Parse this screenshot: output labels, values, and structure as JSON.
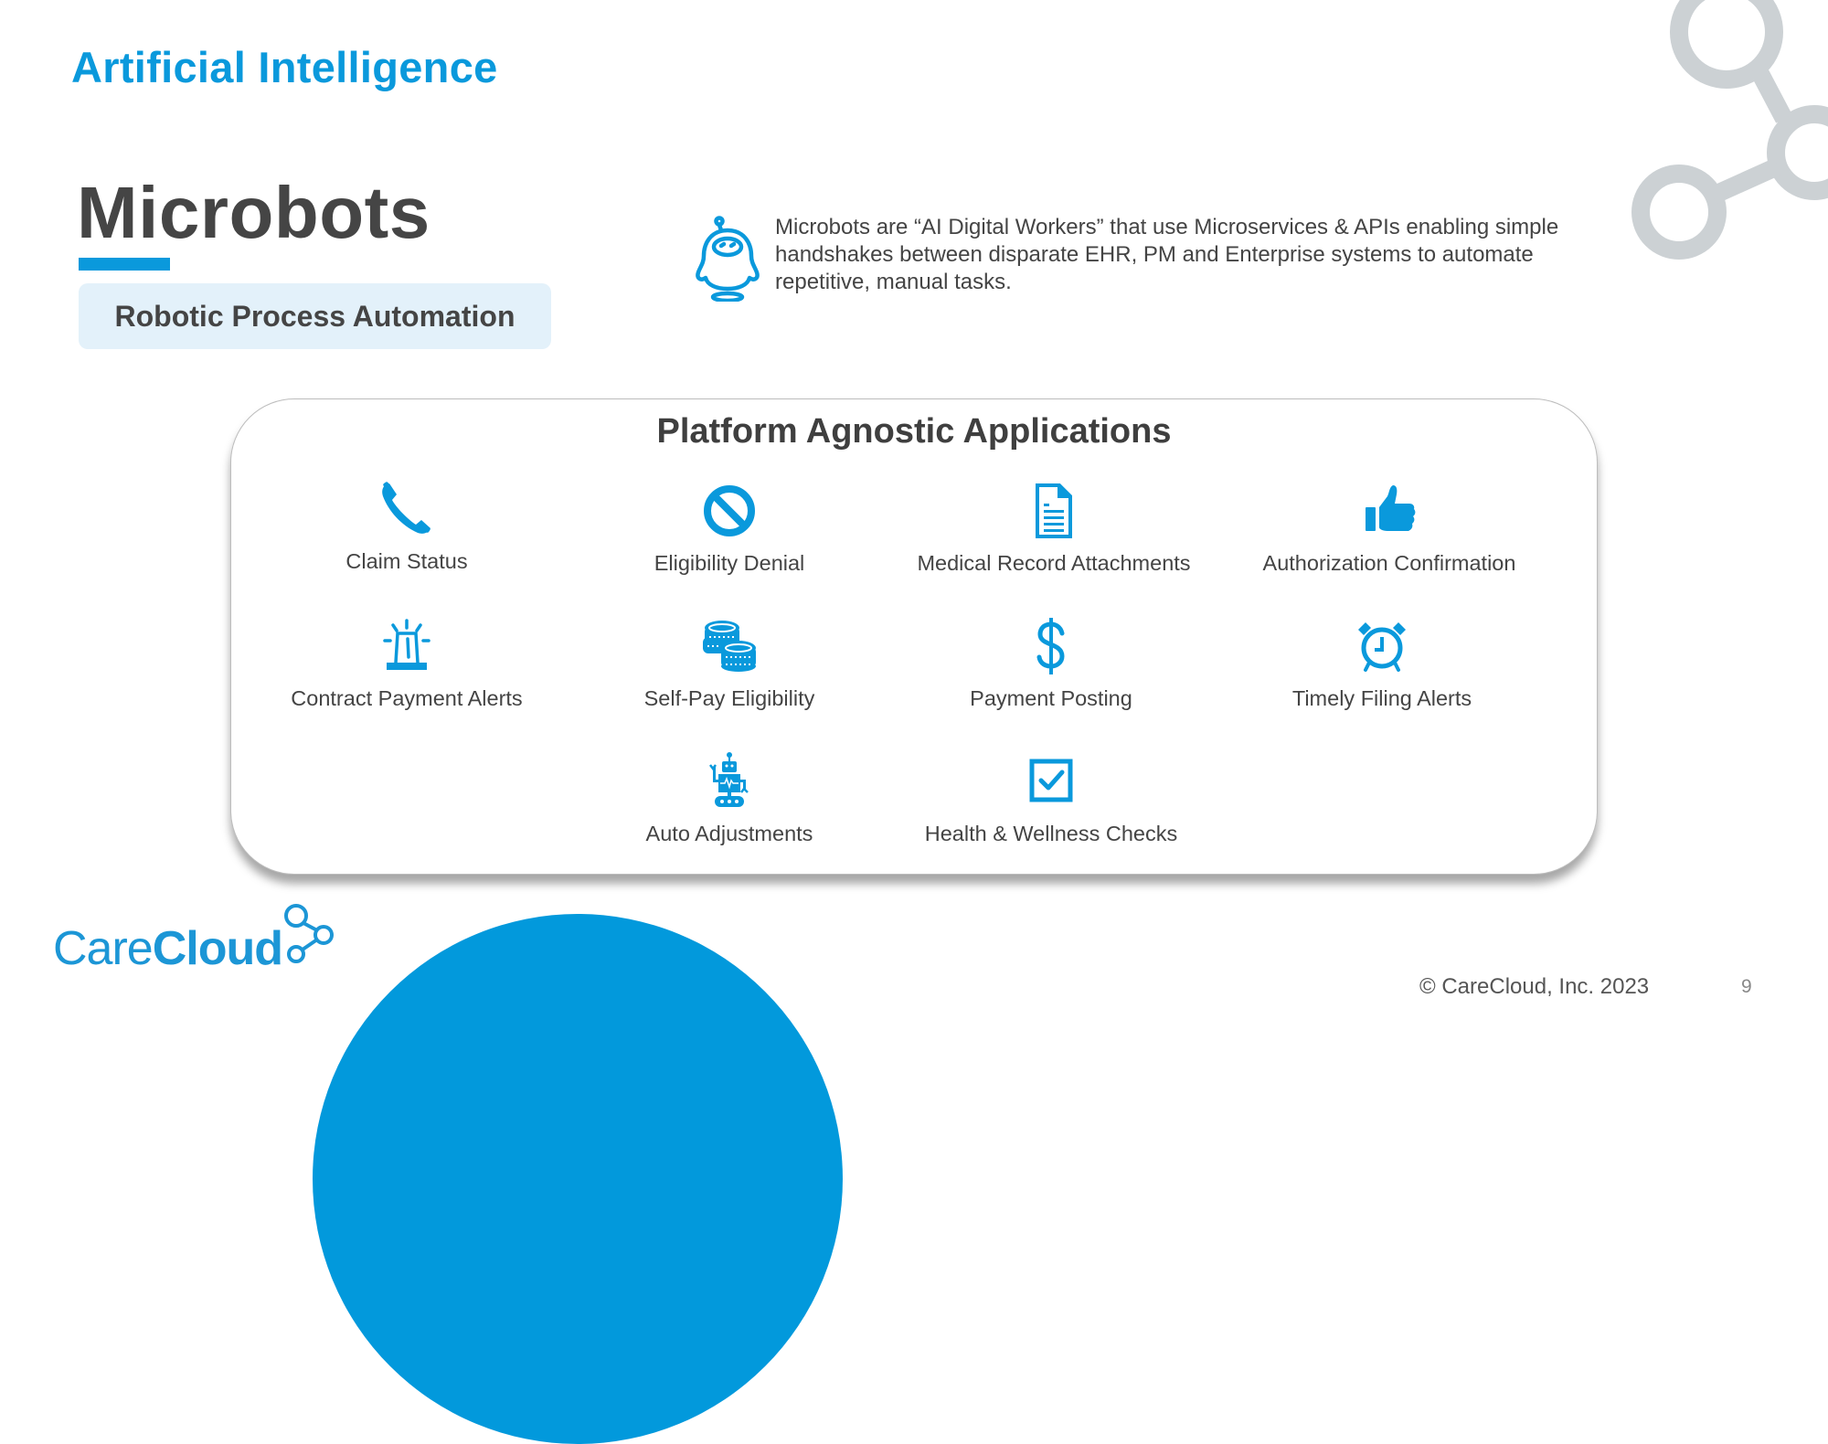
{
  "slide": {
    "section_title": "Artificial Intelligence",
    "title": "Microbots",
    "subtitle": "Robotic Process Automation",
    "description": "Microbots are “AI Digital Workers” that use Microservices & APIs enabling simple handshakes between disparate EHR, PM and Enterprise systems to automate repetitive, manual tasks.",
    "description_icon": "robot-assistant-icon",
    "page_number": "9"
  },
  "card": {
    "title": "Platform Agnostic Applications",
    "applications": [
      {
        "label": "Claim Status",
        "icon": "phone-icon"
      },
      {
        "label": "Eligibility Denial",
        "icon": "prohibited-icon"
      },
      {
        "label": "Medical Record Attachments",
        "icon": "document-icon"
      },
      {
        "label": "Authorization Confirmation",
        "icon": "thumbs-up-icon"
      },
      {
        "label": "Contract Payment Alerts",
        "icon": "siren-icon"
      },
      {
        "label": "Self-Pay Eligibility",
        "icon": "coins-icon"
      },
      {
        "label": "Payment Posting",
        "icon": "dollar-icon"
      },
      {
        "label": "Timely Filing Alerts",
        "icon": "alarm-clock-icon"
      },
      {
        "label": "Auto Adjustments",
        "icon": "robot-icon"
      },
      {
        "label": "Health & Wellness Checks",
        "icon": "checkbox-icon"
      }
    ]
  },
  "footer": {
    "logo_light": "Care",
    "logo_bold": "Cloud",
    "copyright": "© CareCloud, Inc. 2023"
  },
  "colors": {
    "accent": "#0a99dc",
    "heading": "#454545",
    "pill_bg": "#e3f1fa",
    "deco_gray": "#ccd1d4"
  }
}
